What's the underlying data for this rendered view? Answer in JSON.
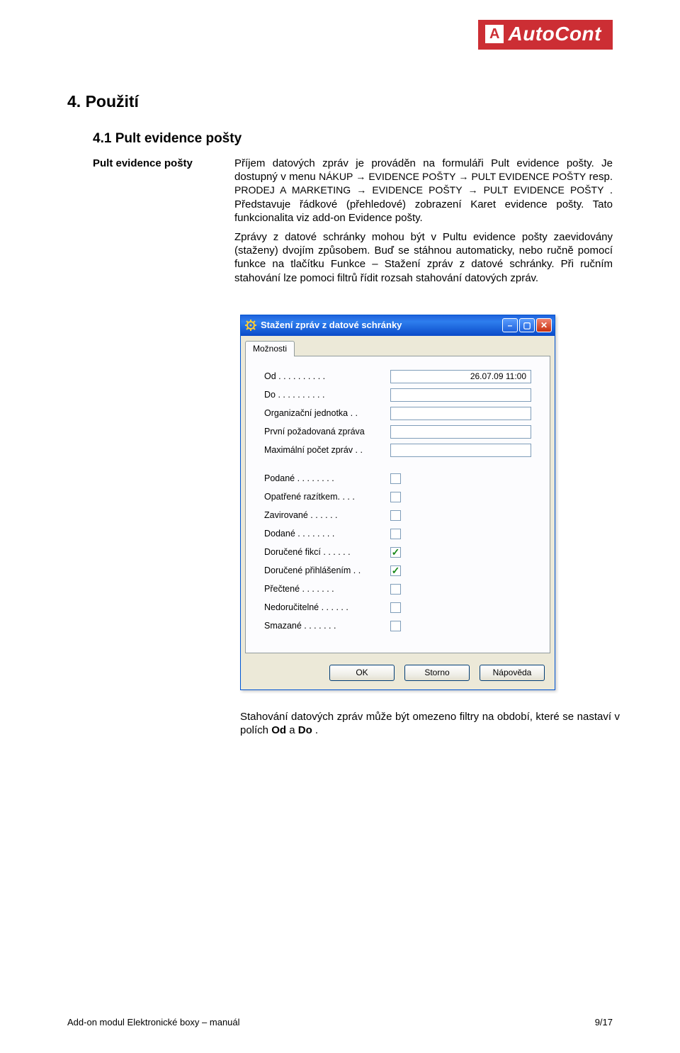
{
  "logo": {
    "text": "AutoCont",
    "icon": "A"
  },
  "section": {
    "title": "4. Použití",
    "subtitle": "4.1 Pult evidence pošty",
    "left_label": "Pult evidence pošty",
    "para1_a": "Příjem datových zpráv je prováděn na formuláři Pult evidence pošty. Je dostupný v menu ",
    "para1_nav1": "NÁKUP → EVIDENCE POŠTY → PULT EVIDENCE POŠTY",
    "para1_b": " resp. ",
    "para1_nav2": "PRODEJ A MARKETING → EVIDENCE POŠTY → PULT EVIDENCE POŠTY",
    "para1_c": ". Představuje řádkové (přehledové) zobrazení Karet evidence pošty. Tato funkcionalita viz add-on Evidence pošty.",
    "para2": "Zprávy z datové schránky mohou být v Pultu evidence pošty zaevidovány (staženy) dvojím způsobem. Buď se stáhnou automaticky, nebo ručně pomocí funkce na tlačítku Funkce – Stažení zpráv z datové schránky. Při ručním stahování lze pomoci filtrů řídit rozsah stahování datových zpráv.",
    "after_a": "Stahování datových zpráv může být omezeno filtry na období, které se nastaví v polích ",
    "after_bold1": "Od",
    "after_mid": " a ",
    "after_bold2": "Do",
    "after_end": "."
  },
  "dialog": {
    "title": "Stažení zpráv z datové schránky",
    "tab": "Možnosti",
    "fields": {
      "od": {
        "label": "Od . . . . . . . . . .",
        "value": "26.07.09 11:00"
      },
      "do": {
        "label": "Do . . . . . . . . . .",
        "value": ""
      },
      "org": {
        "label": "Organizační jednotka  . .",
        "value": ""
      },
      "prvni": {
        "label": "První požadovaná zpráva",
        "value": ""
      },
      "max": {
        "label": "Maximální počet zpráv . .",
        "value": ""
      },
      "podane": {
        "label": "Podané . . . . . . . .",
        "checked": false
      },
      "opatrene": {
        "label": "Opatřené razítkem.  . . .",
        "checked": false
      },
      "zavirov": {
        "label": "Zavirované  . . . . . .",
        "checked": false
      },
      "dodane": {
        "label": "Dodané . . . . . . . .",
        "checked": false
      },
      "fikci": {
        "label": "Doručené fikcí . . . . . .",
        "checked": true
      },
      "prihl": {
        "label": "Doručené přihlášením  . .",
        "checked": true
      },
      "prectene": {
        "label": "Přečtené  . . . . . . .",
        "checked": false
      },
      "nedoruc": {
        "label": "Nedoručitelné . . . . . .",
        "checked": false
      },
      "smazane": {
        "label": "Smazané  . . . . . . .",
        "checked": false
      }
    },
    "buttons": {
      "ok": "OK",
      "storno": "Storno",
      "help": "Nápověda"
    }
  },
  "footer": {
    "left": "Add-on modul Elektronické boxy – manuál",
    "right": "9/17"
  }
}
